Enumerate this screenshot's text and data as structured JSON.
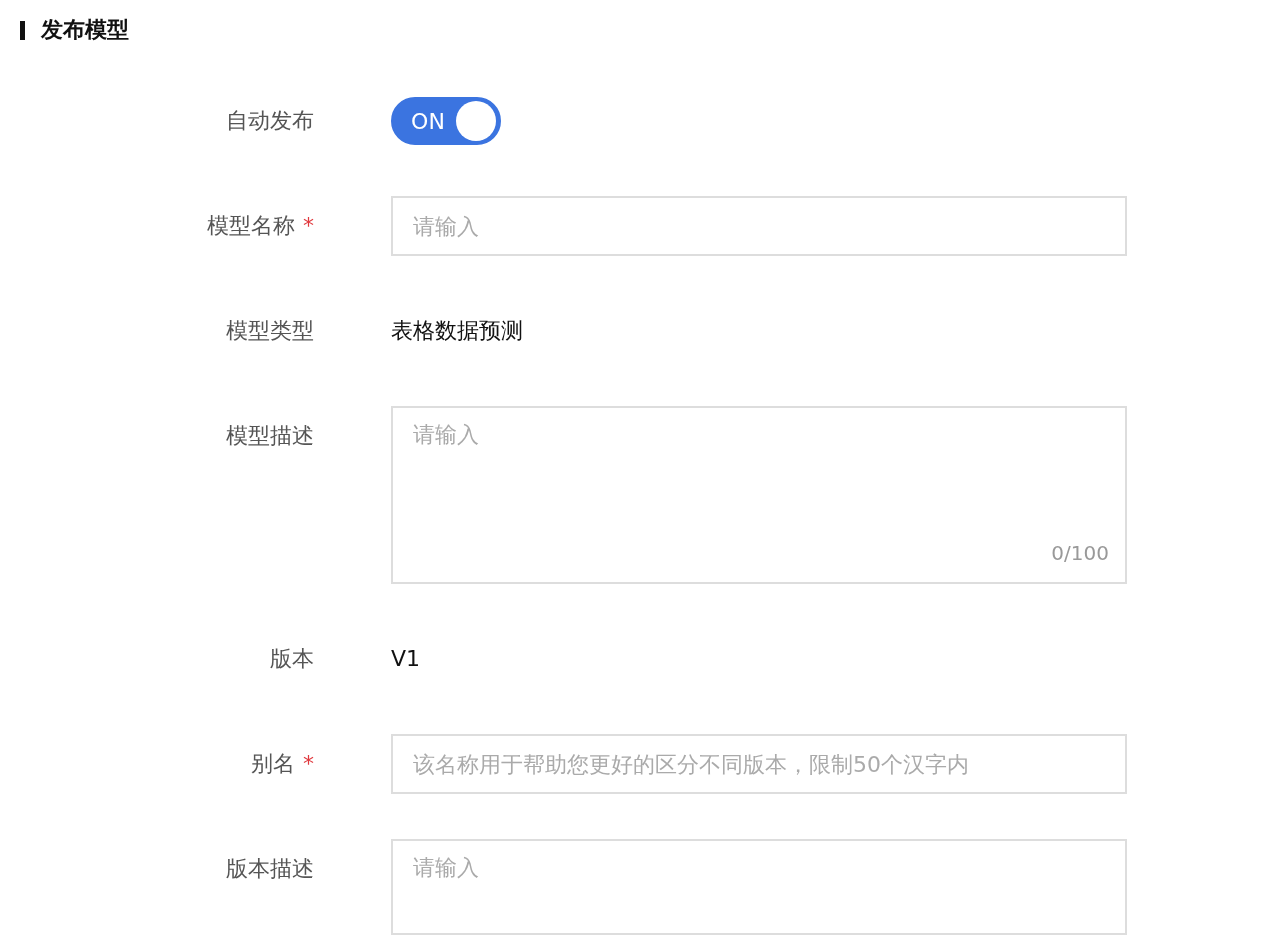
{
  "section_title": "发布模型",
  "fields": [
    {
      "kind": "switch",
      "label": "自动发布",
      "on": true,
      "switch_text": "ON"
    },
    {
      "kind": "input",
      "label": "模型名称",
      "required_mark": "*",
      "placeholder": "请输入"
    },
    {
      "kind": "text",
      "label": "模型类型",
      "value": "表格数据预测"
    },
    {
      "kind": "textarea",
      "label": "模型描述",
      "placeholder": "请输入",
      "counter": "0/100"
    },
    {
      "kind": "text",
      "label": "版本",
      "value": "V1"
    },
    {
      "kind": "input",
      "label": "别名",
      "required_mark": "*",
      "placeholder": "该名称用于帮助您更好的区分不同版本，限制50个汉字内"
    },
    {
      "kind": "textarea_short",
      "label": "版本描述",
      "placeholder": "请输入"
    }
  ]
}
